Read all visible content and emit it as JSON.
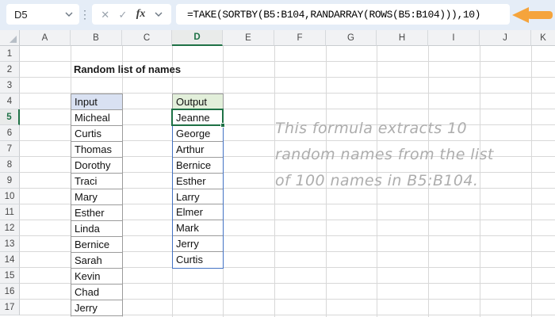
{
  "formula_bar": {
    "name_box_value": "D5",
    "separator_glyph": "⋮",
    "cancel_glyph": "✕",
    "enter_glyph": "✓",
    "fx_label": "fx",
    "formula": "=TAKE(SORTBY(B5:B104,RANDARRAY(ROWS(B5:B104))),10)"
  },
  "grid": {
    "column_letters": [
      "A",
      "B",
      "C",
      "D",
      "E",
      "F",
      "G",
      "H",
      "I",
      "J",
      "K"
    ],
    "row_numbers": [
      "1",
      "2",
      "3",
      "4",
      "5",
      "6",
      "7",
      "8",
      "9",
      "10",
      "11",
      "12",
      "13",
      "14",
      "15",
      "16",
      "17"
    ],
    "selected_cell": "D5",
    "selected_column": "D",
    "selected_row": "5"
  },
  "sheet": {
    "title": "Random list of names",
    "input": {
      "header": "Input",
      "names": [
        "Micheal",
        "Curtis",
        "Thomas",
        "Dorothy",
        "Traci",
        "Mary",
        "Esther",
        "Linda",
        "Bernice",
        "Sarah",
        "Kevin",
        "Chad",
        "Jerry"
      ]
    },
    "output": {
      "header": "Output",
      "names": [
        "Jeanne",
        "George",
        "Arthur",
        "Bernice",
        "Esther",
        "Larry",
        "Elmer",
        "Mark",
        "Jerry",
        "Curtis"
      ]
    }
  },
  "note": {
    "lines": [
      "This formula extracts 10",
      "random names from the list",
      "of 100 names in B5:B104."
    ]
  },
  "colors": {
    "topbar_bg": "#e5edf7",
    "selection_green": "#1e7145",
    "spill_border_blue": "#4372c4",
    "arrow_orange": "#f5a43c",
    "input_header_bg": "#d9e1f2",
    "output_header_bg": "#e2efda",
    "note_gray": "#adadad"
  }
}
